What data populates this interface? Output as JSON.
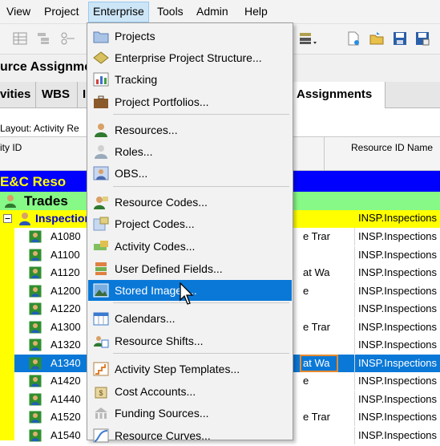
{
  "menubar": {
    "items": [
      "View",
      "Project",
      "Enterprise",
      "Tools",
      "Admin",
      "Help"
    ]
  },
  "title_strip": {
    "text": "urce Assignme"
  },
  "tabs": [
    "vities",
    "WBS",
    "I",
    "Assignments"
  ],
  "layout_bar": {
    "text": "Layout: Activity Re"
  },
  "grid_header": {
    "activity_id": "ity ID",
    "resource_id_name": "Resource ID Name"
  },
  "bands": {
    "ec": "E&C Reso",
    "trades": "Trades",
    "inspection": "Inspection",
    "inspection_resource": "INSP.Inspections"
  },
  "rows": [
    {
      "id": "A1080",
      "frag": "e Trar",
      "res": "INSP.Inspections"
    },
    {
      "id": "A1100",
      "frag": "",
      "res": "INSP.Inspections"
    },
    {
      "id": "A1120",
      "frag": "at Wa",
      "res": "INSP.Inspections"
    },
    {
      "id": "A1200",
      "frag": "e",
      "res": "INSP.Inspections"
    },
    {
      "id": "A1220",
      "frag": "",
      "res": "INSP.Inspections"
    },
    {
      "id": "A1300",
      "frag": "e Trar",
      "res": "INSP.Inspections"
    },
    {
      "id": "A1320",
      "frag": "",
      "res": "INSP.Inspections"
    },
    {
      "id": "A1340",
      "frag": "at Wa",
      "res": "INSP.Inspections",
      "selected": true
    },
    {
      "id": "A1420",
      "frag": "e",
      "res": "INSP.Inspections"
    },
    {
      "id": "A1440",
      "frag": "",
      "res": "INSP.Inspections"
    },
    {
      "id": "A1520",
      "frag": "e Trar",
      "res": "INSP.Inspections"
    },
    {
      "id": "A1540",
      "frag": "",
      "res": "INSP.Inspections"
    }
  ],
  "dropdown": {
    "items": [
      {
        "label": "Projects",
        "icon": "folder-icon"
      },
      {
        "label": "Enterprise Project Structure...",
        "icon": "eps-icon"
      },
      {
        "label": "Tracking",
        "icon": "chart-icon"
      },
      {
        "label": "Project Portfolios...",
        "icon": "briefcase-icon"
      },
      {
        "label": "Resources...",
        "icon": "person-icon"
      },
      {
        "label": "Roles...",
        "icon": "role-icon"
      },
      {
        "label": "OBS...",
        "icon": "obs-icon"
      },
      {
        "label": "Resource Codes...",
        "icon": "resource-codes-icon"
      },
      {
        "label": "Project Codes...",
        "icon": "project-codes-icon"
      },
      {
        "label": "Activity Codes...",
        "icon": "activity-codes-icon"
      },
      {
        "label": "User Defined Fields...",
        "icon": "udf-icon"
      },
      {
        "label": "Stored Images...",
        "icon": "image-icon",
        "hover": true
      },
      {
        "label": "Calendars...",
        "icon": "calendar-icon"
      },
      {
        "label": "Resource Shifts...",
        "icon": "shifts-icon"
      },
      {
        "label": "Activity Step Templates...",
        "icon": "step-templates-icon"
      },
      {
        "label": "Cost Accounts...",
        "icon": "cost-icon"
      },
      {
        "label": "Funding Sources...",
        "icon": "funding-icon"
      },
      {
        "label": "Resource Curves...",
        "icon": "curves-icon"
      }
    ]
  },
  "colors": {
    "selection_blue": "#0a78d7",
    "band_blue": "#0000ff",
    "band_yellow_text": "#ffff00",
    "trades_green": "#86f986",
    "inspection_yellow": "#ffff00"
  }
}
